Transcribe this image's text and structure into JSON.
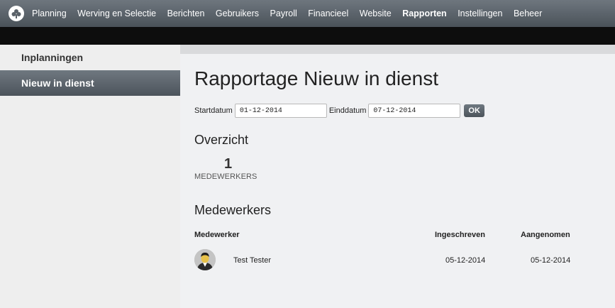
{
  "nav": {
    "logo": "app-logo-icon",
    "items": [
      {
        "label": "Planning"
      },
      {
        "label": "Werving en Selectie"
      },
      {
        "label": "Berichten"
      },
      {
        "label": "Gebruikers"
      },
      {
        "label": "Payroll"
      },
      {
        "label": "Financieel"
      },
      {
        "label": "Website"
      },
      {
        "label": "Rapporten",
        "active": true
      },
      {
        "label": "Instellingen"
      },
      {
        "label": "Beheer"
      }
    ]
  },
  "sidebar": {
    "items": [
      {
        "label": "Inplanningen"
      },
      {
        "label": "Nieuw in dienst",
        "active": true
      }
    ]
  },
  "main": {
    "title": "Rapportage Nieuw in dienst",
    "form": {
      "start_label": "Startdatum",
      "start_value": "01-12-2014",
      "end_label": "Einddatum",
      "end_value": "07-12-2014",
      "ok_label": "OK"
    },
    "overview": {
      "heading": "Overzicht",
      "count": "1",
      "count_label": "MEDEWERKERS"
    },
    "employees": {
      "heading": "Medewerkers",
      "columns": [
        "Medewerker",
        "Ingeschreven",
        "Aangenomen"
      ],
      "rows": [
        {
          "name": "Test Tester",
          "ingeschreven": "05-12-2014",
          "aangenomen": "05-12-2014"
        }
      ]
    }
  },
  "colors": {
    "nav_bg": "#5a6269",
    "accent": "#4c545b",
    "page_bg": "#f0f1f3"
  }
}
